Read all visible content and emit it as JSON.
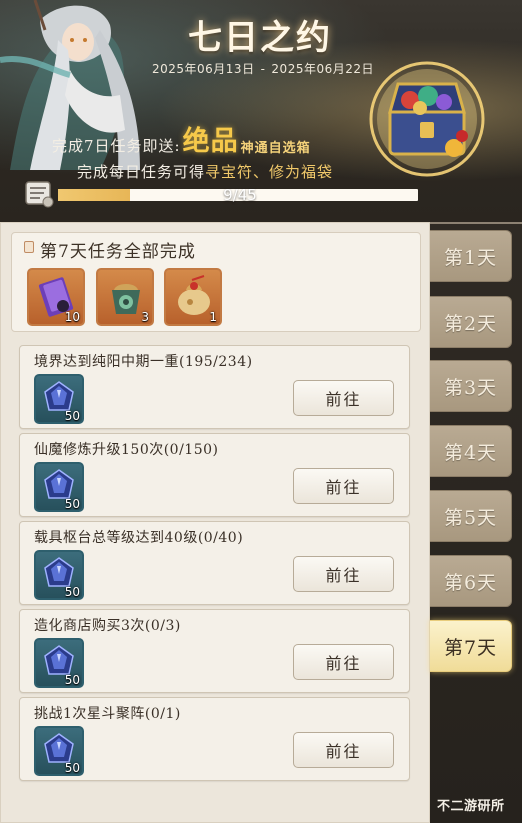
{
  "header": {
    "title": "七日之约",
    "date_start": "2025年06月13日",
    "date_sep": "-",
    "date_end": "2025年06月22日",
    "promo_prefix": "完成7日任务即送:",
    "promo_highlight": "绝品",
    "promo_suffix": "神通自选箱",
    "reward_prefix": "完成每日任务可得",
    "reward_items": "寻宝符、修为福袋",
    "progress": {
      "text": "9/45",
      "current": 9,
      "total": 45
    }
  },
  "completion": {
    "title": "第7天任务全部完成",
    "rewards": [
      {
        "icon": "card-scroll-icon",
        "count": "10"
      },
      {
        "icon": "jade-pouch-icon",
        "count": "3"
      },
      {
        "icon": "treasure-bag-icon",
        "count": "1"
      }
    ]
  },
  "tasks": [
    {
      "title": "境界达到纯阳中期一重(195/234)",
      "reward_count": "50",
      "button": "前往"
    },
    {
      "title": "仙魔修炼升级150次(0/150)",
      "reward_count": "50",
      "button": "前往"
    },
    {
      "title": "载具枢台总等级达到40级(0/40)",
      "reward_count": "50",
      "button": "前往"
    },
    {
      "title": "造化商店购买3次(0/3)",
      "reward_count": "50",
      "button": "前往"
    },
    {
      "title": "挑战1次星斗聚阵(0/1)",
      "reward_count": "50",
      "button": "前往"
    }
  ],
  "day_tabs": [
    {
      "label": "第1天",
      "active": false
    },
    {
      "label": "第2天",
      "active": false
    },
    {
      "label": "第3天",
      "active": false
    },
    {
      "label": "第4天",
      "active": false
    },
    {
      "label": "第5天",
      "active": false
    },
    {
      "label": "第6天",
      "active": false
    },
    {
      "label": "第7天",
      "active": true
    }
  ],
  "watermark": "不二游研所",
  "colors": {
    "accent_gold": "#f6c94a",
    "panel_bg": "#ece6db",
    "tab_active": "#f0dc98",
    "tab_inactive": "#b0a18a"
  }
}
